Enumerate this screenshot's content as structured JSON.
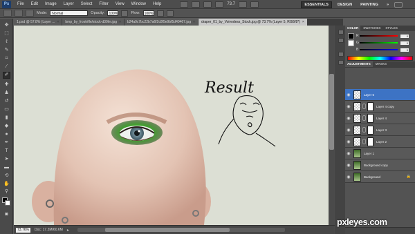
{
  "app": {
    "logo": "Ps"
  },
  "menu": [
    "File",
    "Edit",
    "Image",
    "Layer",
    "Select",
    "Filter",
    "View",
    "Window",
    "Help"
  ],
  "menubar": {
    "zoom": "73.7"
  },
  "workspaces": [
    "ESSENTIALS",
    "DESIGN",
    "PAINTING",
    "»"
  ],
  "options": {
    "mode_label": "Mode:",
    "mode_value": "Normal",
    "opacity_label": "Opacity:",
    "opacity_value": "100%",
    "flow_label": "Flow:",
    "flow_value": "100%"
  },
  "doc_tabs": [
    "1.psd @ 57.8% (Layer ...",
    "bmp_by_frostrifle/stock-d30lm.jpg",
    "b24a9c7bc22b7a6f2c8f5e9bf5d40467.jpg",
    "draper_01_by_Voivodess_Stock.jpg @ 73.7% (Layer 5, RGB/8*)"
  ],
  "doc_tab_close": "×",
  "canvas": {
    "handwriting": "Result"
  },
  "status": {
    "zoom": "73.76%",
    "doc": "Doc: 17.2M/60.6M"
  },
  "panels": {
    "color_tabs": [
      "COLOR",
      "SWATCHES",
      "STYLES"
    ],
    "color": {
      "r_label": "R",
      "r_value": "0",
      "g_label": "G",
      "g_value": "0",
      "b_label": "B",
      "b_value": "0"
    },
    "adj_tabs": [
      "ADJUSTMENTS",
      "MASKS"
    ],
    "layer_tabs": [
      "LAYERS",
      "CHANNELS",
      "PATHS"
    ],
    "blend_mode": "Normal",
    "opacity_label": "Opacity:",
    "opacity_value": "100%",
    "lock_label": "Lock:",
    "fill_label": "Fill:",
    "fill_value": "100%",
    "layers": [
      {
        "name": "Layer 5",
        "active": true
      },
      {
        "name": "Layer 4 copy",
        "active": false
      },
      {
        "name": "Layer 4",
        "active": false
      },
      {
        "name": "Layer 3",
        "active": false
      },
      {
        "name": "Layer 2",
        "active": false
      },
      {
        "name": "Layer 1",
        "active": false
      },
      {
        "name": "Background copy",
        "active": false
      },
      {
        "name": "Background",
        "active": false
      }
    ]
  },
  "watermark": "pxleyes.com",
  "colors": {
    "accent_layer": "#3d73c4",
    "canvas_bg": "#dcdfd4",
    "eye_shadow": "#3fa32b"
  }
}
